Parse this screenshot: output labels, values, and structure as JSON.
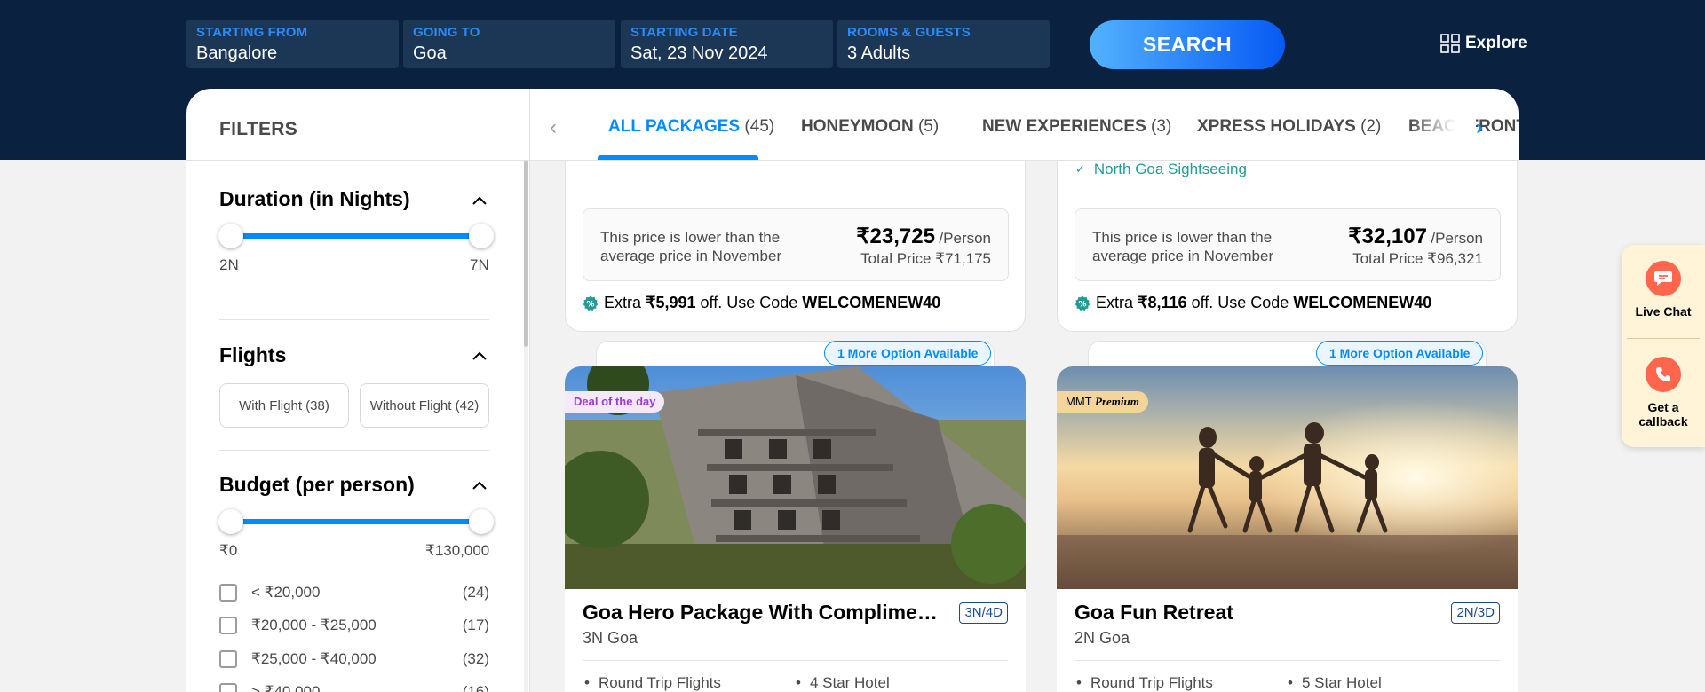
{
  "search": {
    "fields": [
      {
        "label": "STARTING FROM",
        "value": "Bangalore"
      },
      {
        "label": "GOING TO",
        "value": "Goa"
      },
      {
        "label": "STARTING DATE",
        "value": "Sat, 23 Nov 2024"
      },
      {
        "label": "ROOMS & GUESTS",
        "value": "3 Adults"
      }
    ],
    "button": "SEARCH",
    "explore": "Explore"
  },
  "filters": {
    "title": "FILTERS",
    "duration": {
      "title": "Duration (in Nights)",
      "min": "2N",
      "max": "7N",
      "range": [
        2,
        7
      ]
    },
    "flights": {
      "title": "Flights",
      "with": "With Flight (38)",
      "without": "Without Flight (42)"
    },
    "budget": {
      "title": "Budget (per person)",
      "min": "₹0",
      "max": "₹130,000",
      "range": [
        0,
        130000
      ],
      "options": [
        {
          "label": "< ₹20,000",
          "count": "(24)"
        },
        {
          "label": "₹20,000 - ₹25,000",
          "count": "(17)"
        },
        {
          "label": "₹25,000 - ₹40,000",
          "count": "(32)"
        },
        {
          "label": "> ₹40,000",
          "count": "(16)"
        }
      ]
    }
  },
  "tabs": [
    {
      "label": "ALL PACKAGES",
      "count": "(45)",
      "active": true
    },
    {
      "label": "HONEYMOON",
      "count": "(5)"
    },
    {
      "label": "NEW EXPERIENCES",
      "count": "(3)"
    },
    {
      "label": "XPRESS HOLIDAYS",
      "count": "(2)"
    },
    {
      "label": "BEACHFRONT",
      "count": ""
    }
  ],
  "top_cards": [
    {
      "sightseeing": "",
      "note": "This price is lower than the average price in November",
      "price": "₹23,725",
      "per": "/Person",
      "total": "Total Price ₹71,175",
      "offer_prefix": "Extra",
      "offer_amount": "₹5,991",
      "offer_mid": "off. Use Code",
      "offer_code": "WELCOMENEW40"
    },
    {
      "sightseeing": "North Goa Sightseeing",
      "note": "This price is lower than the average price in November",
      "price": "₹32,107",
      "per": "/Person",
      "total": "Total Price ₹96,321",
      "offer_prefix": "Extra",
      "offer_amount": "₹8,116",
      "offer_mid": "off. Use Code",
      "offer_code": "WELCOMENEW40"
    }
  ],
  "packages": [
    {
      "more": "1 More Option Available",
      "tag": "Deal of the day",
      "title": "Goa Hero Package With Complimentary Activities",
      "duration": "3N/4D",
      "sub": "3N Goa",
      "features": [
        "Round Trip Flights",
        "4 Star Hotel"
      ]
    },
    {
      "more": "1 More Option Available",
      "tag_prefix": "MMT",
      "tag_em": "Premium",
      "title": "Goa Fun Retreat",
      "duration": "2N/3D",
      "sub": "2N Goa",
      "features": [
        "Round Trip Flights",
        "5 Star Hotel"
      ]
    }
  ],
  "widget": {
    "chat": "Live Chat",
    "callback": "Get a callback"
  },
  "colors": {
    "header": "#0a223f",
    "accent": "#008cff",
    "field": "#1c3656",
    "offer": "#249995",
    "widget": "#fff3d8",
    "widget_icon": "#ff664b"
  },
  "icons": [
    "grid-icon",
    "chevron-left-icon",
    "chevron-right-icon",
    "chevron-up-icon",
    "check-icon",
    "offer-badge-icon",
    "chat-icon",
    "phone-icon"
  ]
}
